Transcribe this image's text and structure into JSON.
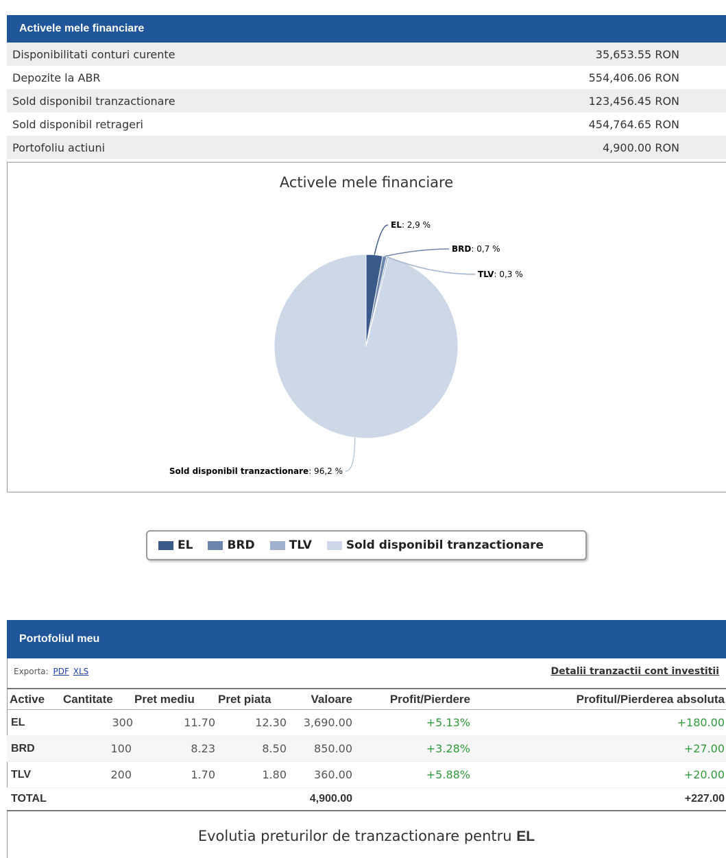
{
  "assets": {
    "header": "Activele mele financiare",
    "rows": [
      {
        "label": "Disponibilitati conturi curente",
        "value": "35,653.55 RON"
      },
      {
        "label": "Depozite la ABR",
        "value": "554,406.06 RON"
      },
      {
        "label": "Sold disponibil tranzactionare",
        "value": "123,456.45 RON"
      },
      {
        "label": "Sold disponibil retrageri",
        "value": "454,764.65 RON"
      },
      {
        "label": "Portofoliu actiuni",
        "value": "4,900.00 RON"
      }
    ]
  },
  "chart_data": {
    "type": "pie",
    "title": "Activele mele financiare",
    "slices": [
      {
        "name": "EL",
        "percent": 2.9,
        "label": "2,9 %",
        "color": "#3a5a8c"
      },
      {
        "name": "BRD",
        "percent": 0.7,
        "label": "0,7 %",
        "color": "#6d86b0"
      },
      {
        "name": "TLV",
        "percent": 0.3,
        "label": "0,3 %",
        "color": "#9fb1cf"
      },
      {
        "name": "Sold disponibil tranzactionare",
        "percent": 96.2,
        "label": "96,2 %",
        "color": "#ccd7e8"
      }
    ],
    "legend_placement": "bottom"
  },
  "portfolio": {
    "header": "Portofoliul meu",
    "export_label": "Exporta:",
    "export_pdf": "PDF",
    "export_xls": "XLS",
    "details_link": "Detalii tranzactii cont investitii",
    "columns": [
      "Active",
      "Cantitate",
      "Pret mediu",
      "Pret piata",
      "Valoare",
      "Profit/Pierdere",
      "Profitul/Pierderea absoluta"
    ],
    "rows": [
      {
        "symbol": "EL",
        "qty": "300",
        "avg": "11.70",
        "market": "12.30",
        "value": "3,690.00",
        "pct": "+5.13%",
        "abs": "+180.00"
      },
      {
        "symbol": "BRD",
        "qty": "100",
        "avg": "8.23",
        "market": "8.50",
        "value": "850.00",
        "pct": "+3.28%",
        "abs": "+27.00"
      },
      {
        "symbol": "TLV",
        "qty": "200",
        "avg": "1.70",
        "market": "1.80",
        "value": "360.00",
        "pct": "+5.88%",
        "abs": "+20.00"
      }
    ],
    "total": {
      "label": "TOTAL",
      "value": "4,900.00",
      "abs": "+227.00"
    }
  },
  "evolution": {
    "title_prefix": "Evolutia preturilor de tranzactionare pentru",
    "symbol": "EL"
  },
  "colors": {
    "header_bg": "#1f5599",
    "positive": "#2e9a3a"
  }
}
